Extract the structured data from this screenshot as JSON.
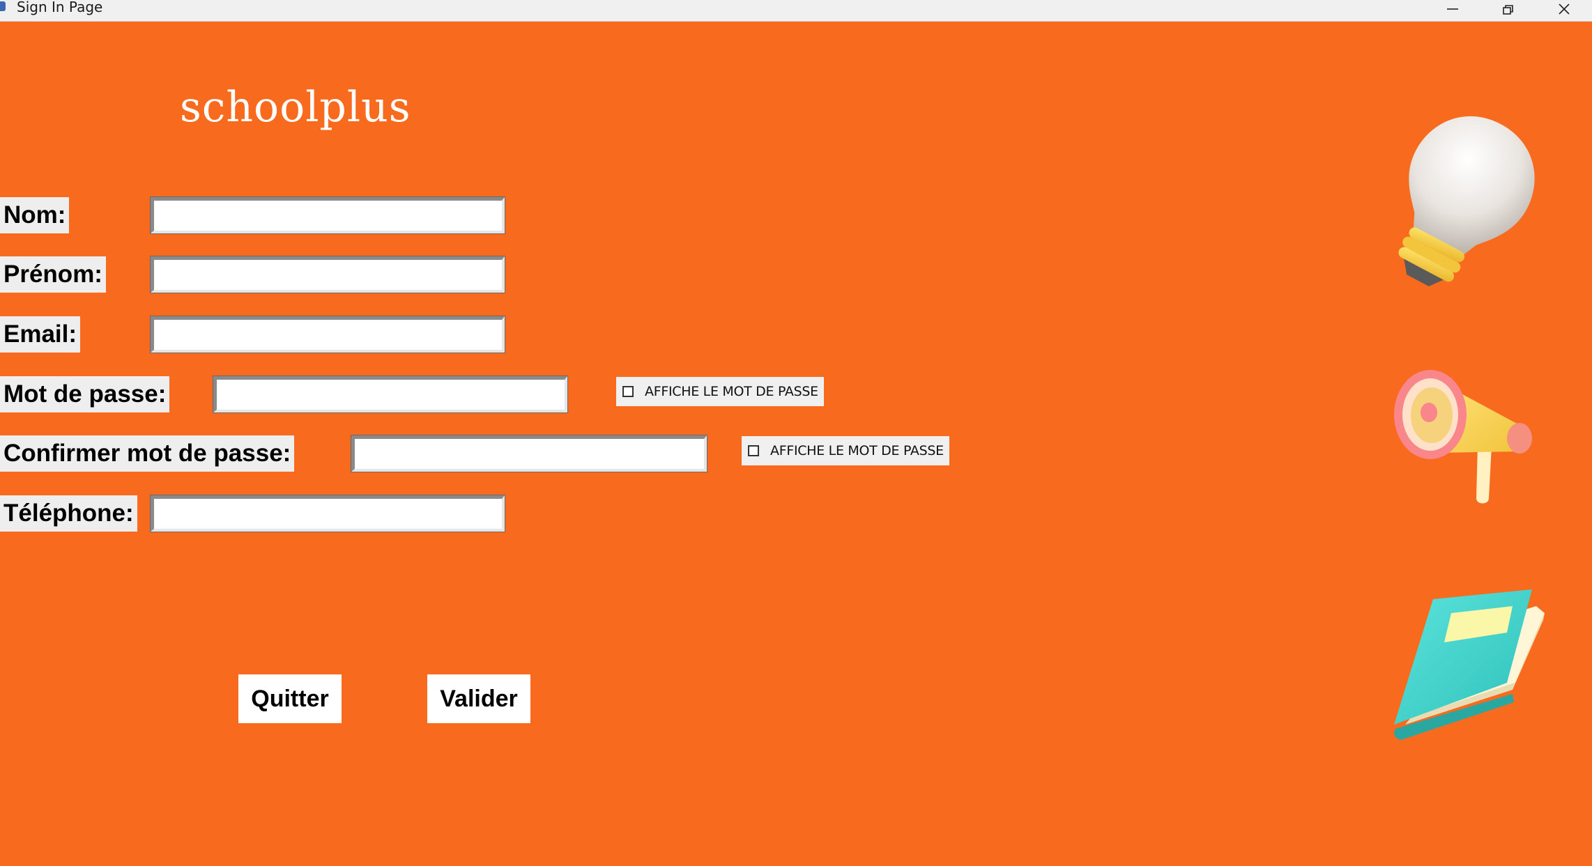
{
  "window": {
    "title": "Sign In Page"
  },
  "brand": {
    "name": "schoolplus"
  },
  "form": {
    "nom_label": "Nom:",
    "prenom_label": "Prénom:",
    "email_label": "Email:",
    "password_label": "Mot de passe:",
    "confirm_password_label": "Confirmer mot de passe:",
    "telephone_label": "Téléphone:",
    "nom_value": "",
    "prenom_value": "",
    "email_value": "",
    "password_value": "",
    "confirm_password_value": "",
    "telephone_value": "",
    "show_password_label": "AFFICHE LE MOT DE PASSE",
    "show_confirm_password_label": "AFFICHE LE MOT DE PASSE",
    "show_password_checked": false,
    "show_confirm_password_checked": false
  },
  "buttons": {
    "quit_label": "Quitter",
    "submit_label": "Valider"
  },
  "illustrations": [
    "lightbulb-icon",
    "megaphone-icon",
    "book-icon"
  ],
  "colors": {
    "background": "#f86b1f",
    "label_background": "#eeeeee",
    "button_background": "#ffffff",
    "titlebar": "#f0f0f0"
  }
}
